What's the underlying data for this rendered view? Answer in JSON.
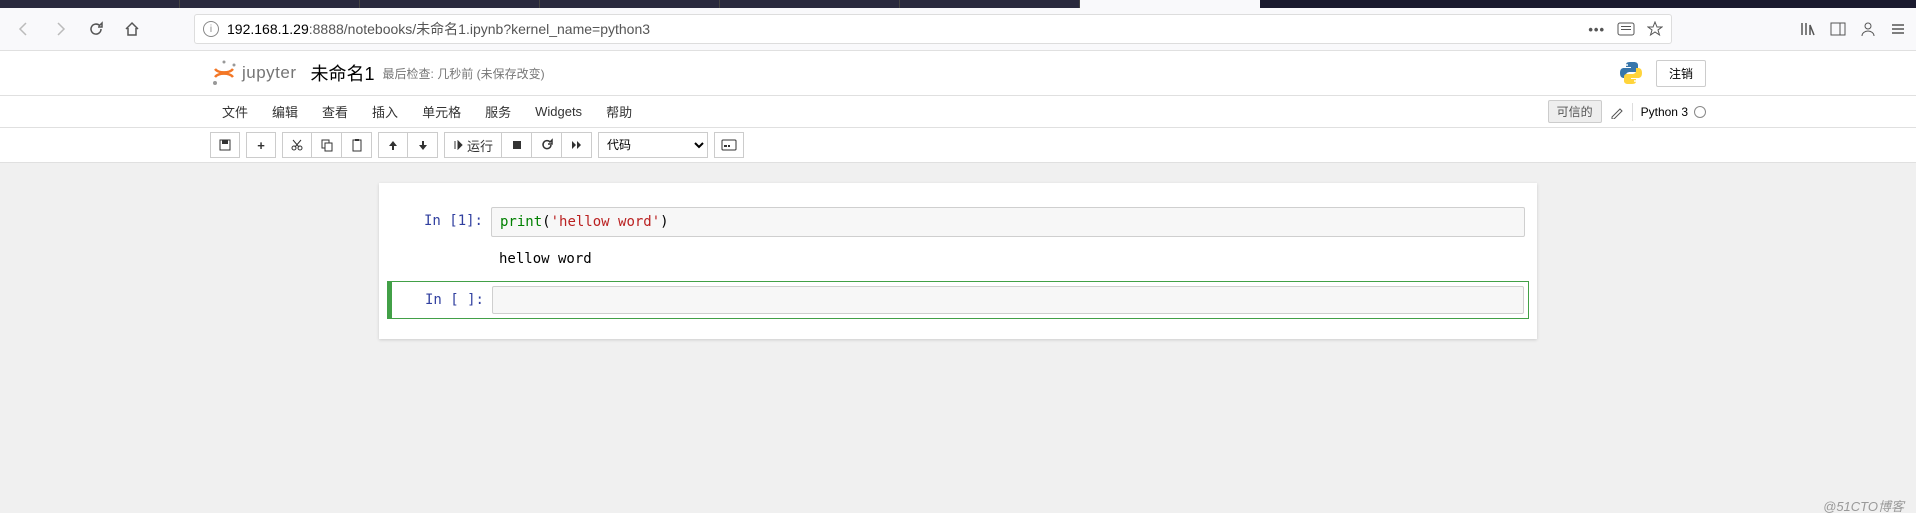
{
  "browser": {
    "url_host": "192.168.1.29",
    "url_path": ":8888/notebooks/未命名1.ipynb?kernel_name=python3"
  },
  "header": {
    "logo_text": "jupyter",
    "notebook_name": "未命名1",
    "checkpoint_label": "最后检查:",
    "checkpoint_time": "几秒前",
    "checkpoint_status": "(未保存改变)",
    "logout_label": "注销"
  },
  "menu": {
    "items": [
      "文件",
      "编辑",
      "查看",
      "插入",
      "单元格",
      "服务",
      "Widgets",
      "帮助"
    ],
    "trusted_label": "可信的",
    "kernel_name": "Python 3"
  },
  "toolbar": {
    "run_label": "运行",
    "cell_type_selected": "代码"
  },
  "cells": [
    {
      "prompt": "In  [1]:",
      "code_prefix": "print",
      "code_paren_open": "(",
      "code_string": "'hellow word'",
      "code_paren_close": ")",
      "output": "hellow word"
    },
    {
      "prompt": "In  [ ]:",
      "code": ""
    }
  ],
  "watermark": "@51CTO博客"
}
